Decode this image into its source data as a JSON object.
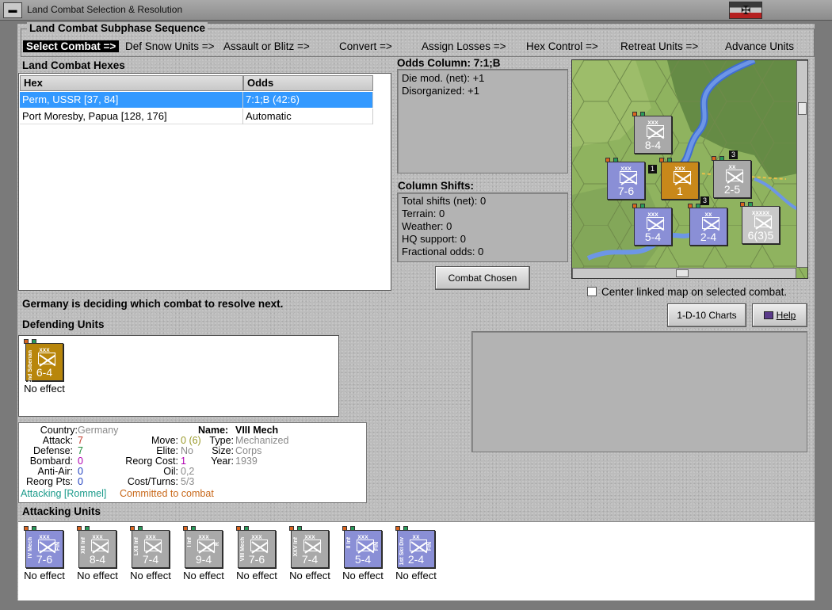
{
  "window": {
    "title": "Land Combat Selection & Resolution"
  },
  "phase": {
    "title": "Land Combat Subphase Sequence",
    "steps": [
      "Select Combat =>",
      "Def Snow Units =>",
      "Assault or Blitz =>",
      "Convert =>",
      "Assign Losses =>",
      "Hex Control =>",
      "Retreat Units =>",
      "Advance Units"
    ]
  },
  "hexes": {
    "label": "Land Combat Hexes",
    "columns": [
      "Hex",
      "Odds"
    ],
    "rows": [
      {
        "hex": "Perm, USSR [37, 84]",
        "odds": "7:1;B (42:6)",
        "selected": true
      },
      {
        "hex": "Port Moresby, Papua [128, 176]",
        "odds": "Automatic",
        "selected": false
      }
    ]
  },
  "odds": {
    "label": "Odds Column: 7:1;B",
    "lines": [
      "Die mod. (net): +1",
      "Disorganized: +1"
    ]
  },
  "shifts": {
    "label": "Column Shifts:",
    "lines": [
      "Total shifts (net): 0",
      "Terrain: 0",
      "Weather: 0",
      "HQ support: 0",
      "Fractional odds: 0"
    ]
  },
  "buttons": {
    "combat_chosen": "Combat Chosen",
    "charts": "1-D-10 Charts",
    "help": "Help"
  },
  "center_map_label": "Center linked map on selected combat.",
  "status": "Germany is deciding which combat to resolve next.",
  "defending": {
    "label": "Defending Units",
    "units": [
      {
        "size": "xxx",
        "name": "2nd Siberian",
        "value": "6-4",
        "caption": "No effect",
        "color": "#b8860b"
      }
    ]
  },
  "details": {
    "country_label": "Country:",
    "country": "Germany",
    "attack_label": "Attack:",
    "attack": "7",
    "defense_label": "Defense:",
    "defense": "7",
    "bombard_label": "Bombard:",
    "bombard": "0",
    "antiair_label": "Anti-Air:",
    "antiair": "0",
    "reorgpts_label": "Reorg Pts:",
    "reorgpts": "0",
    "name_label": "Name:",
    "name": "VIII Mech",
    "move_label": "Move:",
    "move": "0",
    "move_paren": "(6)",
    "elite_label": "Elite:",
    "elite": "No",
    "reorgcost_label": "Reorg Cost:",
    "reorgcost": "1",
    "oil_label": "Oil:",
    "oil": "0,2",
    "costturns_label": "Cost/Turns:",
    "costturns": "5/3",
    "type_label": "Type:",
    "type": "Mechanized",
    "size_label": "Size:",
    "size": "Corps",
    "year_label": "Year:",
    "year": "1939",
    "attacking_with": "Attacking [Rommel]",
    "committed": "Committed to combat"
  },
  "attacking": {
    "label": "Attacking Units",
    "units": [
      {
        "size": "xxx",
        "name": "IV Mech",
        "nat": "FIN",
        "value": "7-6",
        "caption": "No effect",
        "color": "#8a8fd6"
      },
      {
        "size": "xxx",
        "name": "XIII Inf",
        "nat": "",
        "value": "8-4",
        "caption": "No effect",
        "color": "#a9a9a9"
      },
      {
        "size": "xxx",
        "name": "LXII Inf",
        "nat": "",
        "value": "7-4",
        "caption": "No effect",
        "color": "#a9a9a9"
      },
      {
        "size": "xxx",
        "name": "I Inf",
        "nat": "R",
        "value": "9-4",
        "caption": "No effect",
        "color": "#a9a9a9"
      },
      {
        "size": "xxx",
        "name": "VIII Mech",
        "nat": "",
        "value": "7-6",
        "caption": "No effect",
        "color": "#a9a9a9"
      },
      {
        "size": "xxx",
        "name": "XXV Inf",
        "nat": "",
        "value": "7-4",
        "caption": "No effect",
        "color": "#a9a9a9"
      },
      {
        "size": "xxx",
        "name": "II Inf",
        "nat": "FIN",
        "value": "5-4",
        "caption": "No effect",
        "color": "#8a8fd6"
      },
      {
        "size": "xx",
        "name": "1st Ski Div",
        "nat": "FIN",
        "value": "2-4",
        "caption": "No effect",
        "color": "#8a8fd6"
      }
    ]
  },
  "map_units": [
    {
      "size": "xxx",
      "value": "8-4",
      "color": "#a9a9a9"
    },
    {
      "size": "xxx",
      "value": "7-6",
      "color": "#8a8fd6"
    },
    {
      "size": "xxx",
      "value": "1",
      "color": "#c8881a"
    },
    {
      "size": "xx",
      "value": "2-5",
      "color": "#a9a9a9"
    },
    {
      "size": "xxx",
      "value": "5-4",
      "color": "#8a8fd6"
    },
    {
      "size": "xx",
      "value": "2-4",
      "color": "#8a8fd6"
    },
    {
      "size": "xxxxx",
      "value": "6(3)5",
      "color": "#c8c8c8"
    }
  ],
  "map_stack_counts": [
    "1",
    "3",
    "3"
  ]
}
